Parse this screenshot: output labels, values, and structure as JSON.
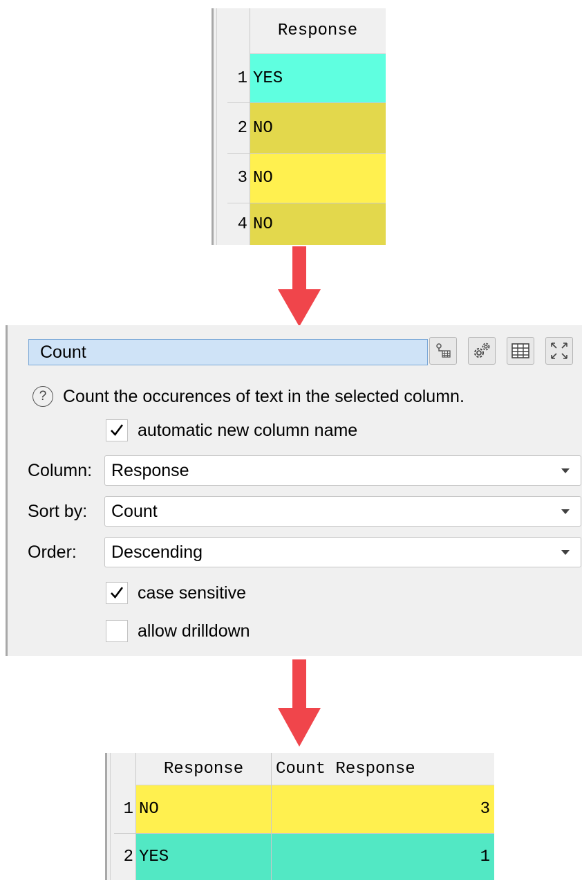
{
  "input_table": {
    "header": "Response",
    "rows": [
      {
        "num": "1",
        "value": "YES",
        "color": "#5fffe0"
      },
      {
        "num": "2",
        "value": "NO",
        "color": "#e3d84c"
      },
      {
        "num": "3",
        "value": "NO",
        "color": "#fff04f"
      },
      {
        "num": "4",
        "value": "NO",
        "color": "#e3d84c"
      }
    ]
  },
  "panel": {
    "title": "Count",
    "toolbar_icons": [
      "properties-icon",
      "settings-gears-icon",
      "table-icon",
      "maximize-icon"
    ],
    "description": "Count the occurences of text in the selected column.",
    "auto_name": {
      "checked": true,
      "label": "automatic new column name"
    },
    "column": {
      "label": "Column:",
      "value": "Response"
    },
    "sort_by": {
      "label": "Sort by:",
      "value": "Count"
    },
    "order": {
      "label": "Order:",
      "value": "Descending"
    },
    "case_sensitive": {
      "checked": true,
      "label": "case sensitive"
    },
    "allow_drilldown": {
      "checked": false,
      "label": "allow drilldown"
    }
  },
  "output_table": {
    "headers": [
      "Response",
      "Count Response"
    ],
    "rows": [
      {
        "num": "1",
        "response": "NO",
        "count": "3",
        "color": "#fff04f"
      },
      {
        "num": "2",
        "response": "YES",
        "count": "1",
        "color": "#52e8c4"
      }
    ]
  },
  "colors": {
    "arrow": "#f0454b",
    "title_bg": "#cfe3f7",
    "panel_bg": "#f0f0f0"
  }
}
